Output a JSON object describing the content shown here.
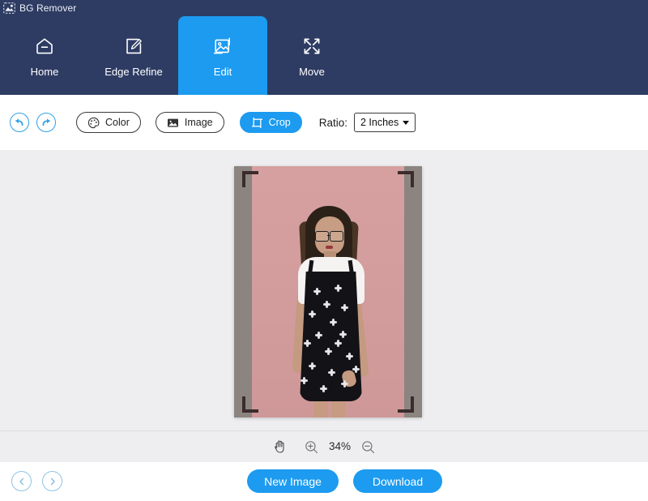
{
  "titlebar": {
    "app_name": "BG Remover",
    "logo_icon": "image-photo-icon"
  },
  "nav": {
    "tabs": [
      {
        "label": "Home",
        "icon": "home-icon",
        "active": false
      },
      {
        "label": "Edge Refine",
        "icon": "pen-edit-icon",
        "active": false
      },
      {
        "label": "Edit",
        "icon": "image-edit-icon",
        "active": true
      },
      {
        "label": "Move",
        "icon": "move-arrows-icon",
        "active": false
      }
    ]
  },
  "toolbar": {
    "undo_icon": "undo-arrow-icon",
    "redo_icon": "redo-arrow-icon",
    "color_label": "Color",
    "color_icon": "palette-icon",
    "image_label": "Image",
    "image_icon": "picture-icon",
    "crop_label": "Crop",
    "crop_icon": "crop-frame-icon",
    "ratio_label": "Ratio:",
    "ratio_value": "2 Inches",
    "ratio_options": [
      "2 Inches"
    ]
  },
  "canvas": {
    "background_color": "#eeeef0",
    "photo_background_color": "#d39d9d",
    "photo_border_color": "#8c8480",
    "crop_handle_color": "#3a2c2c"
  },
  "zoom": {
    "pan_icon": "hand-pan-icon",
    "zoom_in_icon": "zoom-in-icon",
    "level": "34%",
    "zoom_out_icon": "zoom-out-icon"
  },
  "bottombar": {
    "prev_icon": "chevron-left-icon",
    "next_icon": "chevron-right-icon",
    "new_image_label": "New Image",
    "download_label": "Download"
  },
  "colors": {
    "navy": "#2e3c63",
    "accent_blue": "#1c9bf0",
    "canvas_gray": "#eeeef0",
    "white": "#ffffff"
  }
}
